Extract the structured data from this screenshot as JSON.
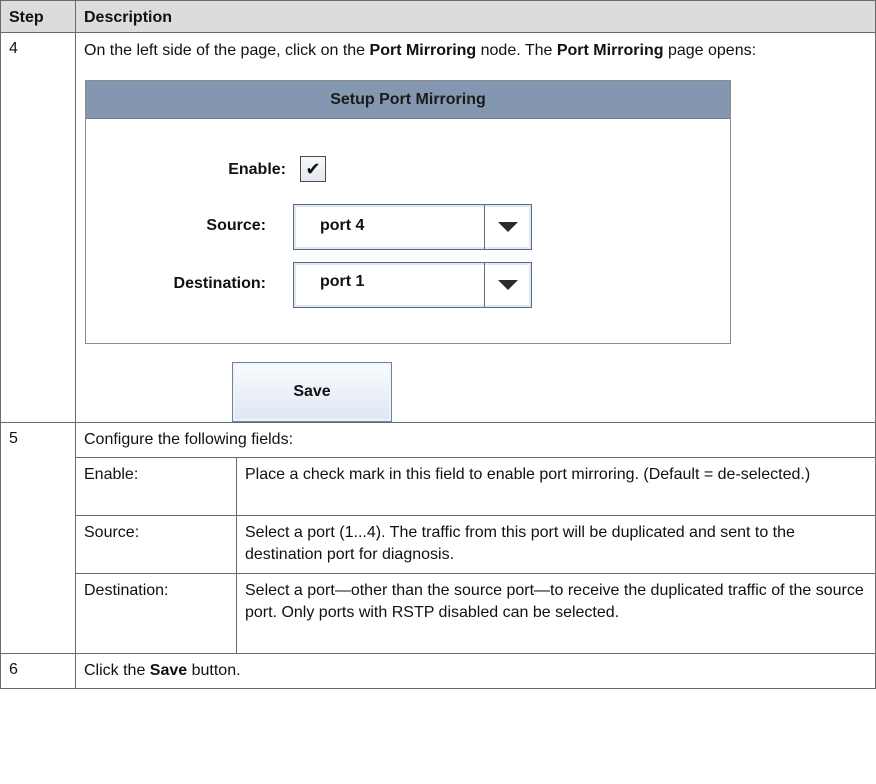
{
  "table": {
    "header": {
      "step": "Step",
      "description": "Description"
    },
    "row4": {
      "step": "4",
      "text_before": "On the left side of the page, click on the ",
      "bold1": "Port Mirroring",
      "text_mid": " node. The ",
      "bold2": "Port Mirroring",
      "text_after": " page opens:"
    },
    "row5": {
      "step": "5",
      "intro": "Configure the following fields:",
      "fields": [
        {
          "name": "Enable:",
          "desc": "Place a check mark in this field to enable port mirroring. (Default = de-selected.)"
        },
        {
          "name": "Source:",
          "desc": "Select a port (1...4). The traffic from this port will be duplicated and sent to the destination port for diagnosis."
        },
        {
          "name": "Destination:",
          "desc": "Select a port—other than the source port—to receive the duplicated traffic of the source port. Only ports with RSTP disabled can be selected."
        }
      ]
    },
    "row6": {
      "step": "6",
      "text_before": "Click the ",
      "bold": "Save",
      "text_after": " button."
    }
  },
  "panel": {
    "title": "Setup Port Mirroring",
    "enable_label": "Enable:",
    "enable_checked_glyph": "✔",
    "source_label": "Source:",
    "source_value": "port 4",
    "destination_label": "Destination:",
    "destination_value": "port 1",
    "save_label": "Save"
  },
  "icons": {
    "dropdown": "triangle-down-icon",
    "check": "checkmark-icon"
  },
  "colors": {
    "header_bg": "#dcdcdc",
    "panel_header_bg": "#8497b0",
    "border": "#6a6a6a"
  }
}
